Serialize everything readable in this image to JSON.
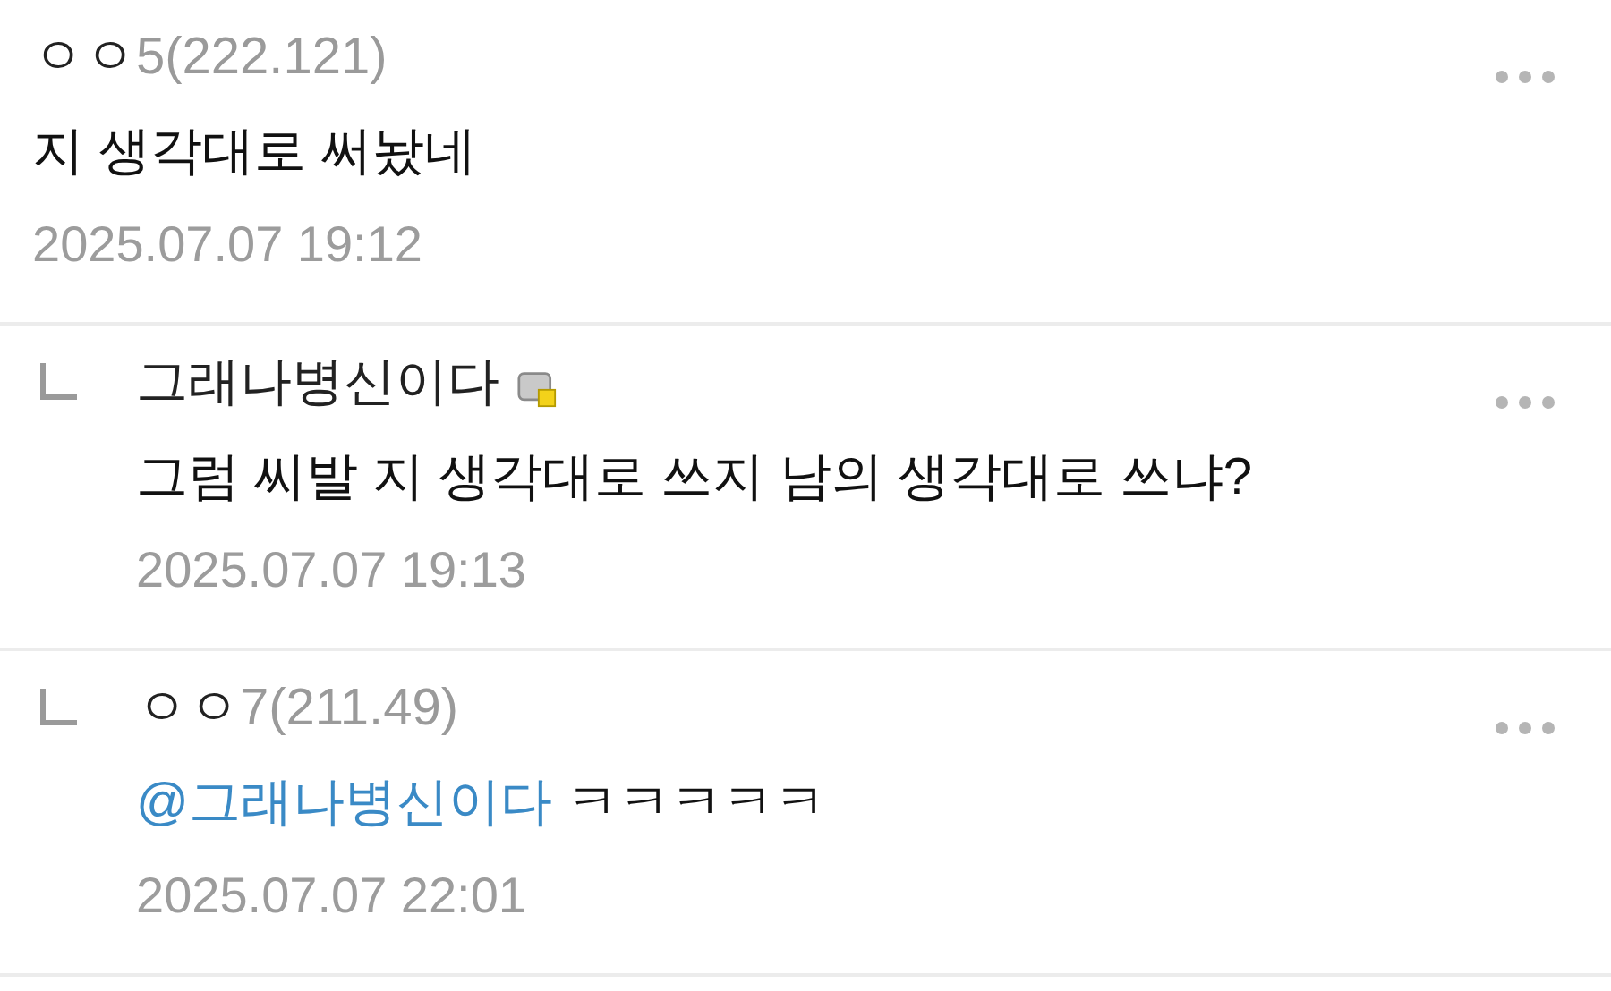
{
  "comments": [
    {
      "kind": "comment",
      "author": "ㅇㅇ",
      "author_suffix": "5(222.121)",
      "body": "지 생각대로 써놨네",
      "date": "2025.07.07 19:12"
    },
    {
      "kind": "reply",
      "author": "그래나병신이다",
      "badge": true,
      "body": "그럼 씨발 지 생각대로 쓰지 남의 생각대로 쓰냐?",
      "date": "2025.07.07 19:13"
    },
    {
      "kind": "reply",
      "author": "ㅇㅇ",
      "author_suffix": "7(211.49)",
      "mention": "@그래나병신이다",
      "body": "ㅋㅋㅋㅋㅋ",
      "date": "2025.07.07 22:01"
    }
  ]
}
